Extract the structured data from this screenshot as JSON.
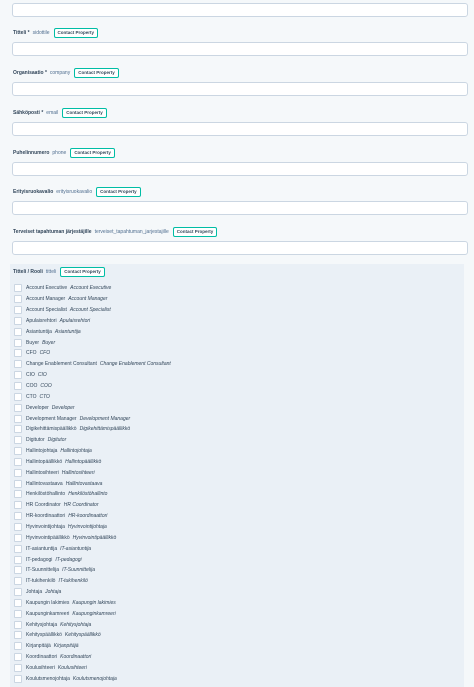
{
  "form": {
    "fields": [
      {
        "label": "Titteli *",
        "internal": "sidottile",
        "badge": "Contact Property"
      },
      {
        "label": "Organisaatio *",
        "internal": "company",
        "badge": "Contact Property"
      },
      {
        "label": "Sähköposti *",
        "internal": "email",
        "badge": "Contact Property"
      },
      {
        "label": "Puhelinnumero",
        "internal": "phone",
        "badge": "Contact Property"
      },
      {
        "label": "Erityisruokavalio",
        "internal": "erityisruokavalio",
        "badge": "Contact Property"
      },
      {
        "label": "Terveiset tapahtuman järjestäjille",
        "internal": "terveiset_tapahtuman_jarjestajille",
        "badge": "Contact Property"
      }
    ],
    "checklist_field": {
      "label": "Titteli / Rooli",
      "internal": "titteli",
      "badge": "Contact Property"
    },
    "options": [
      {
        "label": "Account Executive",
        "internal": "Account Executive"
      },
      {
        "label": "Account Manager",
        "internal": "Account Manager"
      },
      {
        "label": "Account Specialist",
        "internal": "Account Specialist"
      },
      {
        "label": "Apulaisrehtori",
        "internal": "Apulaisrehtori"
      },
      {
        "label": "Asiantuntija",
        "internal": "Asiantuntija"
      },
      {
        "label": "Buyer",
        "internal": "Buyer"
      },
      {
        "label": "CFO",
        "internal": "CFO"
      },
      {
        "label": "Change Enablement Consultant",
        "internal": "Change Enablement Consultant"
      },
      {
        "label": "CIO",
        "internal": "CIO"
      },
      {
        "label": "COO",
        "internal": "COO"
      },
      {
        "label": "CTO",
        "internal": "CTO"
      },
      {
        "label": "Developer",
        "internal": "Developer"
      },
      {
        "label": "Development Manager",
        "internal": "Development Manager"
      },
      {
        "label": "Digikehittämispäällikkö",
        "internal": "Digikehittämispäällikkö"
      },
      {
        "label": "Digitutor",
        "internal": "Digitutor"
      },
      {
        "label": "Hallintojohtaja",
        "internal": "Hallintojohtaja"
      },
      {
        "label": "Hallintopäällikkö",
        "internal": "Hallintopäällikkö"
      },
      {
        "label": "Hallintosihteeri",
        "internal": "Hallintosihteeri"
      },
      {
        "label": "Hallintovastaava",
        "internal": "Hallintovastaava"
      },
      {
        "label": "Henkilöstöhallinto",
        "internal": "Henkilöstöhallinto"
      },
      {
        "label": "HR Coordinator",
        "internal": "HR Coordinator"
      },
      {
        "label": "HR-koordinaattori",
        "internal": "HR-koordinaattori"
      },
      {
        "label": "Hyvinvointijohtaja",
        "internal": "Hyvinvointijohtaja"
      },
      {
        "label": "Hyvinvointipäällikkö",
        "internal": "Hyvinvointipäällikkö"
      },
      {
        "label": "IT-asiantuntija",
        "internal": "IT-asiantuntija"
      },
      {
        "label": "IT-pedagogi",
        "internal": "IT-pedagogi"
      },
      {
        "label": "IT-Suunnittelija",
        "internal": "IT-Suunnittelija"
      },
      {
        "label": "IT-tukihenkilö",
        "internal": "IT-tukihenkilö"
      },
      {
        "label": "Johtaja",
        "internal": "Johtaja"
      },
      {
        "label": "Kaupungin lakimies",
        "internal": "Kaupungin lakimies"
      },
      {
        "label": "Kaupunginkamreeri",
        "internal": "Kaupunginkamreeri"
      },
      {
        "label": "Kehitysjohtaja",
        "internal": "Kehitysjohtaja"
      },
      {
        "label": "Kehityspäällikkö",
        "internal": "Kehityspäällikkö"
      },
      {
        "label": "Kirjanpitäjä",
        "internal": "Kirjanpitäjä"
      },
      {
        "label": "Koordinaattori",
        "internal": "Koordinaattori"
      },
      {
        "label": "Koulusihteeri",
        "internal": "Koulusihteeri"
      },
      {
        "label": "Koulutsmenojohtaja",
        "internal": "Koulutsmenojohtaja"
      }
    ]
  }
}
